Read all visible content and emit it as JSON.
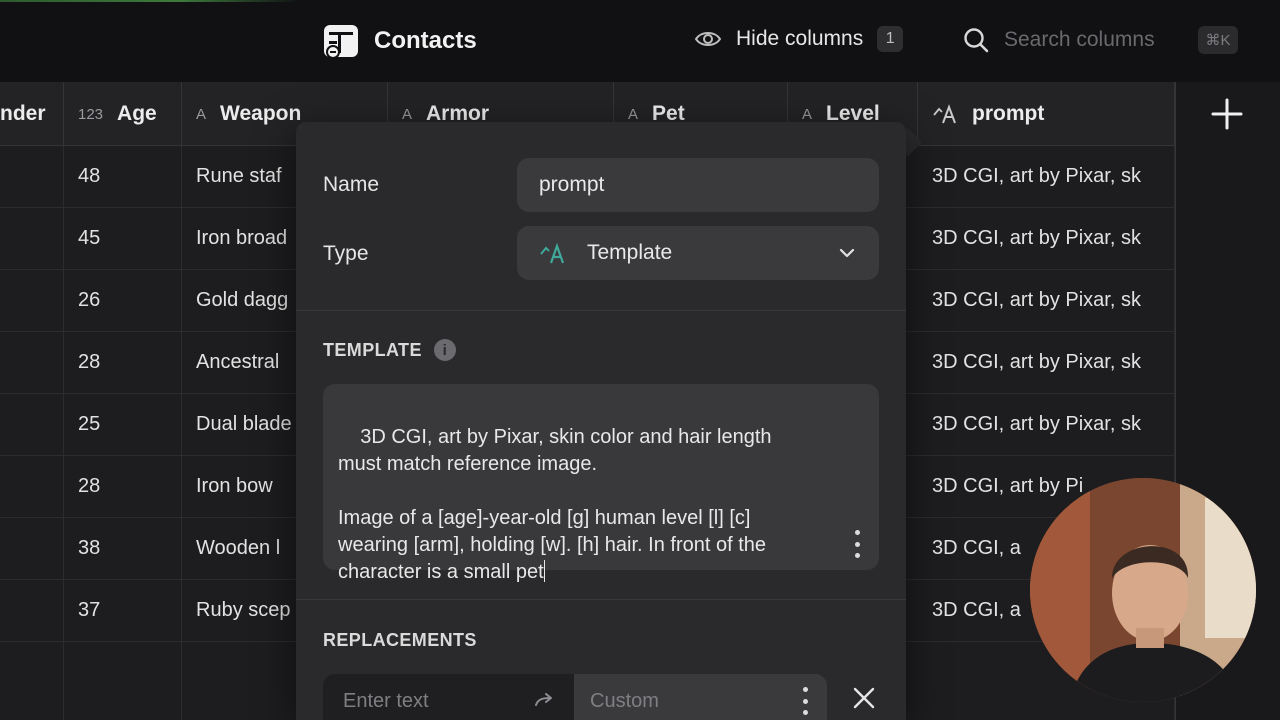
{
  "app": {
    "title": "Contacts"
  },
  "toolbar": {
    "hide_columns_label": "Hide columns",
    "hidden_count": "1",
    "search_placeholder": "Search columns",
    "shortcut": "⌘K"
  },
  "columns": [
    {
      "label": "nder",
      "type_icon": ""
    },
    {
      "label": "Age",
      "type_icon": "123"
    },
    {
      "label": "Weapon",
      "type_icon": "A"
    },
    {
      "label": "Armor",
      "type_icon": "A"
    },
    {
      "label": "Pet",
      "type_icon": "A"
    },
    {
      "label": "Level",
      "type_icon": "A"
    },
    {
      "label": "prompt",
      "type_icon": "template"
    }
  ],
  "rows": [
    {
      "age": "48",
      "weapon": "Rune staf",
      "prompt": "3D CGI, art by Pixar, sk"
    },
    {
      "age": "45",
      "weapon": "Iron broad",
      "prompt": "3D CGI, art by Pixar, sk"
    },
    {
      "age": "26",
      "weapon": "Gold dagg",
      "prompt": "3D CGI, art by Pixar, sk"
    },
    {
      "age": "28",
      "weapon": "Ancestral",
      "prompt": "3D CGI, art by Pixar, sk"
    },
    {
      "age": "25",
      "weapon": "Dual blade",
      "prompt": "3D CGI, art by Pixar, sk"
    },
    {
      "age": "28",
      "weapon": "Iron bow",
      "prompt": "3D CGI, art by Pi"
    },
    {
      "age": "38",
      "weapon": "Wooden l",
      "prompt": "3D CGI, a"
    },
    {
      "age": "37",
      "weapon": "Ruby scep",
      "prompt": "3D CGI, a"
    }
  ],
  "editor": {
    "name_label": "Name",
    "name_value": "prompt",
    "type_label": "Type",
    "type_value": "Template",
    "template_heading": "TEMPLATE",
    "template_text": "3D CGI, art by Pixar, skin color and hair length must match reference image.\n\nImage of a [age]-year-old [g] human level [l] [c] wearing [arm], holding [w]. [h] hair. In front of the character is a small pet",
    "replacements_heading": "REPLACEMENTS",
    "replacement_placeholder": "Enter text",
    "replacement_mode": "Custom"
  },
  "icons": {
    "app": "table-template-icon",
    "hide": "eye-icon",
    "search": "search-icon",
    "add": "plus-icon",
    "type": "template-icon",
    "dropdown": "chevron-down-icon",
    "info": "info-icon",
    "more": "kebab-icon",
    "arrow": "arrow-right-icon",
    "remove": "close-icon"
  },
  "colors": {
    "accent": "#3fa89a",
    "background": "#1b1b1d",
    "panel": "#2a2a2c"
  }
}
